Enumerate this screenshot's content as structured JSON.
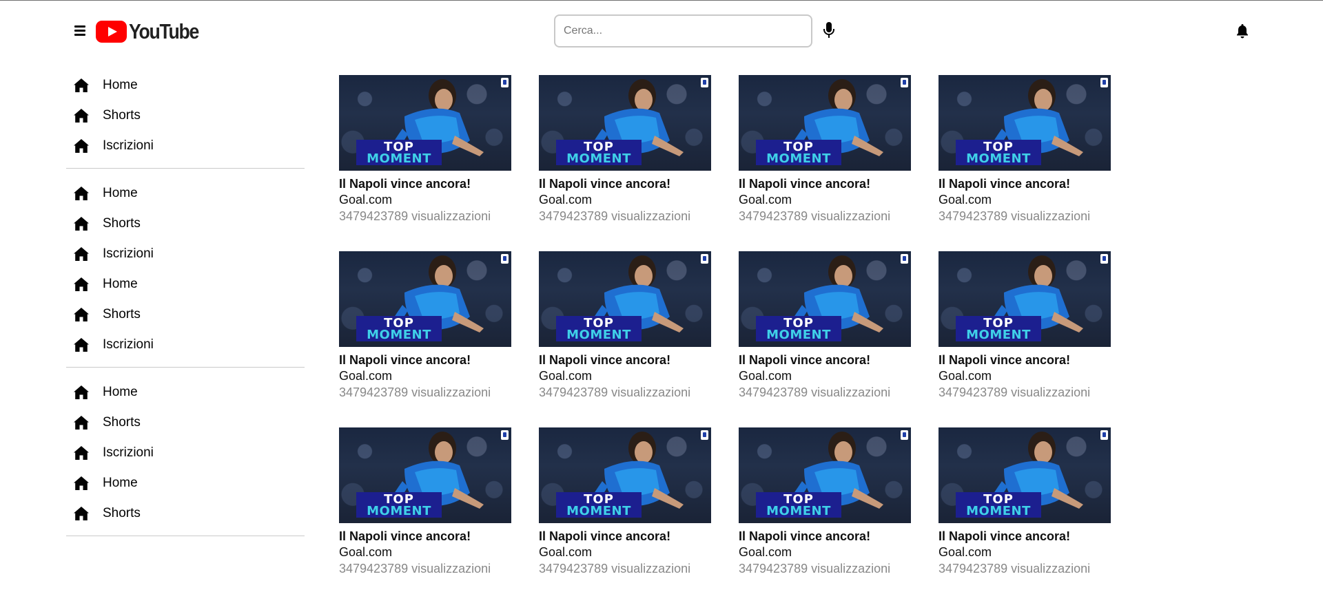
{
  "header": {
    "logo_text": "YouTube",
    "search_placeholder": "Cerca...",
    "search_value": "",
    "menu_icon": "hamburger-menu-icon",
    "mic_icon": "microphone-icon",
    "bell_icon": "bell-icon"
  },
  "colors": {
    "brand_red": "#ff0000",
    "muted_text": "#888888",
    "badge_blue": "#1c1f8f",
    "badge_cyan": "#3fd0e8"
  },
  "sidebar": {
    "sections": [
      {
        "items": [
          {
            "label": "Home",
            "icon": "home-icon"
          },
          {
            "label": "Shorts",
            "icon": "home-icon"
          },
          {
            "label": "Iscrizioni",
            "icon": "home-icon"
          }
        ]
      },
      {
        "items": [
          {
            "label": "Home",
            "icon": "home-icon"
          },
          {
            "label": "Shorts",
            "icon": "home-icon"
          },
          {
            "label": "Iscrizioni",
            "icon": "home-icon"
          },
          {
            "label": "Home",
            "icon": "home-icon"
          },
          {
            "label": "Shorts",
            "icon": "home-icon"
          },
          {
            "label": "Iscrizioni",
            "icon": "home-icon"
          }
        ]
      },
      {
        "items": [
          {
            "label": "Home",
            "icon": "home-icon"
          },
          {
            "label": "Shorts",
            "icon": "home-icon"
          },
          {
            "label": "Iscrizioni",
            "icon": "home-icon"
          },
          {
            "label": "Home",
            "icon": "home-icon"
          },
          {
            "label": "Shorts",
            "icon": "home-icon"
          }
        ]
      }
    ]
  },
  "videos": [
    {
      "title": "Il Napoli vince ancora!",
      "channel": "Goal.com",
      "views": "3479423789 visualizzazioni",
      "badge_top": "TOP",
      "badge_bottom": "MOMENT"
    },
    {
      "title": "Il Napoli vince ancora!",
      "channel": "Goal.com",
      "views": "3479423789 visualizzazioni",
      "badge_top": "TOP",
      "badge_bottom": "MOMENT"
    },
    {
      "title": "Il Napoli vince ancora!",
      "channel": "Goal.com",
      "views": "3479423789 visualizzazioni",
      "badge_top": "TOP",
      "badge_bottom": "MOMENT"
    },
    {
      "title": "Il Napoli vince ancora!",
      "channel": "Goal.com",
      "views": "3479423789 visualizzazioni",
      "badge_top": "TOP",
      "badge_bottom": "MOMENT"
    },
    {
      "title": "Il Napoli vince ancora!",
      "channel": "Goal.com",
      "views": "3479423789 visualizzazioni",
      "badge_top": "TOP",
      "badge_bottom": "MOMENT"
    },
    {
      "title": "Il Napoli vince ancora!",
      "channel": "Goal.com",
      "views": "3479423789 visualizzazioni",
      "badge_top": "TOP",
      "badge_bottom": "MOMENT"
    },
    {
      "title": "Il Napoli vince ancora!",
      "channel": "Goal.com",
      "views": "3479423789 visualizzazioni",
      "badge_top": "TOP",
      "badge_bottom": "MOMENT"
    },
    {
      "title": "Il Napoli vince ancora!",
      "channel": "Goal.com",
      "views": "3479423789 visualizzazioni",
      "badge_top": "TOP",
      "badge_bottom": "MOMENT"
    },
    {
      "title": "Il Napoli vince ancora!",
      "channel": "Goal.com",
      "views": "3479423789 visualizzazioni",
      "badge_top": "TOP",
      "badge_bottom": "MOMENT"
    },
    {
      "title": "Il Napoli vince ancora!",
      "channel": "Goal.com",
      "views": "3479423789 visualizzazioni",
      "badge_top": "TOP",
      "badge_bottom": "MOMENT"
    },
    {
      "title": "Il Napoli vince ancora!",
      "channel": "Goal.com",
      "views": "3479423789 visualizzazioni",
      "badge_top": "TOP",
      "badge_bottom": "MOMENT"
    },
    {
      "title": "Il Napoli vince ancora!",
      "channel": "Goal.com",
      "views": "3479423789 visualizzazioni",
      "badge_top": "TOP",
      "badge_bottom": "MOMENT"
    }
  ]
}
